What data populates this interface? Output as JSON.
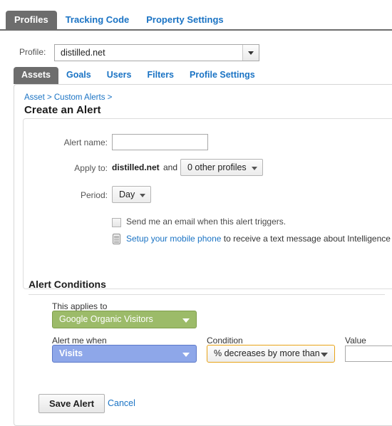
{
  "top_tabs": [
    {
      "label": "Profiles",
      "active": true
    },
    {
      "label": "Tracking Code",
      "active": false
    },
    {
      "label": "Property Settings",
      "active": false
    }
  ],
  "profile_selector": {
    "label": "Profile:",
    "value": "distilled.net",
    "icon": "chevron-down-icon"
  },
  "sub_tabs": [
    {
      "label": "Assets",
      "active": true
    },
    {
      "label": "Goals",
      "active": false
    },
    {
      "label": "Users",
      "active": false
    },
    {
      "label": "Filters",
      "active": false
    },
    {
      "label": "Profile Settings",
      "active": false
    }
  ],
  "breadcrumb": "Asset > Custom Alerts >",
  "page_title": "Create an Alert",
  "form": {
    "alert_name": {
      "label": "Alert name:",
      "value": "",
      "placeholder": ""
    },
    "apply_to": {
      "label": "Apply to:",
      "profile": "distilled.net",
      "conjunction": "and",
      "other_profiles_button": "0 other profiles"
    },
    "period": {
      "label": "Period:",
      "value": "Day"
    },
    "email_checkbox": {
      "label": "Send me an email when this alert triggers.",
      "checked": false
    },
    "mobile_row": {
      "icon": "mobile-phone-icon",
      "link_text": "Setup your mobile phone",
      "rest_text": " to receive a text message about Intelligence Alerts"
    }
  },
  "alert_conditions": {
    "heading": "Alert Conditions",
    "applies_to": {
      "label": "This applies to",
      "value": "Google Organic Visitors",
      "color": "#9cbb69"
    },
    "alert_me_when": {
      "label": "Alert me when",
      "value": "Visits",
      "color": "#8ea7e9"
    },
    "condition": {
      "label": "Condition",
      "value": "% decreases by more than",
      "color": "#e8a317"
    },
    "value_field": {
      "label": "Value",
      "value": "",
      "placeholder": ""
    }
  },
  "footer": {
    "save_label": "Save Alert",
    "cancel_label": "Cancel"
  }
}
